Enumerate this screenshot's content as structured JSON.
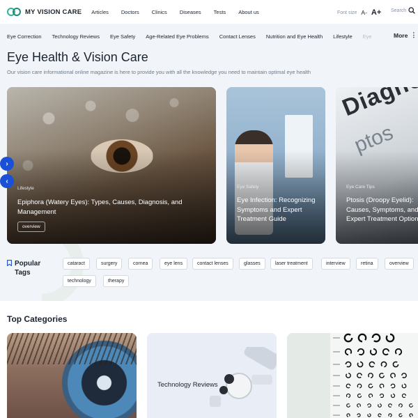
{
  "brand": {
    "name": "MY VISION CARE"
  },
  "nav": {
    "items": [
      "Articles",
      "Doctors",
      "Clinics",
      "Diseases",
      "Tests",
      "About us"
    ]
  },
  "toolbar": {
    "font_size_label": "Font size",
    "decrease_label": "A-",
    "increase_label": "A+",
    "search_label": "Search"
  },
  "categories": {
    "items": [
      "Eye Correction",
      "Technology Reviews",
      "Eye Safety",
      "Age-Related Eye Problems",
      "Contact Lenses",
      "Nutrition and Eye Health",
      "Lifestyle",
      "Eye"
    ],
    "more_label": "More"
  },
  "hero": {
    "title": "Eye Health & Vision Care",
    "subtitle": "Our vision care informational online magazine is here to provide you with all the knowledge you need to maintain optimal eye health"
  },
  "featured": [
    {
      "tag": "Lifestyle",
      "title": "Epiphora (Watery Eyes): Types, Causes, Diagnosis, and Management",
      "chip": "overview"
    },
    {
      "tag": "Eye Safety",
      "title": "Eye Infection: Recognizing Symptoms and Expert Treatment Guide"
    },
    {
      "tag": "Eye Care Tips",
      "title": "Ptosis (Droopy Eyelid): Causes, Symptoms, and Expert Treatment Options"
    }
  ],
  "card_text": {
    "diagnosis_word": "Diagno",
    "ptosis_word": "ptos"
  },
  "popular_tags": {
    "label": "Popular Tags",
    "items": [
      "cataract",
      "surgery",
      "cornea",
      "eye lens",
      "contact lenses",
      "glasses",
      "laser treatment",
      "interview",
      "retina",
      "overview",
      "technology",
      "therapy"
    ]
  },
  "top_categories": {
    "title": "Top Categories",
    "cards": [
      {
        "label": ""
      },
      {
        "label": "Technology Reviews"
      },
      {
        "label": ""
      }
    ]
  },
  "colors": {
    "accent": "#1a4fd8",
    "brand_green": "#2fb59a",
    "background": "#f1f4f8"
  },
  "icons": {
    "search": "search-icon",
    "bookmark": "bookmark-icon",
    "arrow_right": "chevron-right-icon",
    "arrow_left": "chevron-left-icon"
  }
}
